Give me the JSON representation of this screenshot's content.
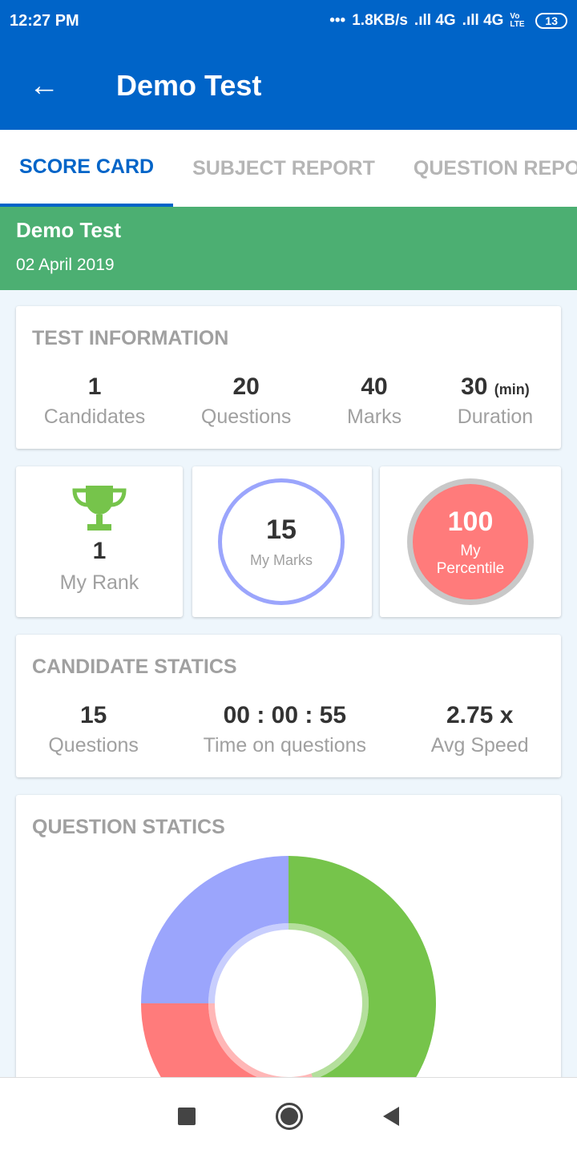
{
  "status_bar": {
    "time": "12:27 PM",
    "dots": "•••",
    "speed": "1.8KB/s",
    "net1": ".ıll 4G",
    "net2": ".ıll 4G",
    "volte": "Vo LTE",
    "battery": "13"
  },
  "app_bar": {
    "title": "Demo Test",
    "back_icon": "arrow-left"
  },
  "tabs": [
    {
      "label": "SCORE CARD",
      "active": true
    },
    {
      "label": "SUBJECT REPORT"
    },
    {
      "label": "QUESTION REPORT"
    }
  ],
  "banner": {
    "title": "Demo Test",
    "date": "02 April 2019",
    "color": "#4caf72"
  },
  "test_info": {
    "title": "TEST INFORMATION",
    "items": [
      {
        "value": "1",
        "label": "Candidates"
      },
      {
        "value": "20",
        "label": "Questions"
      },
      {
        "value": "40",
        "label": "Marks"
      },
      {
        "value": "30",
        "unit": "(min)",
        "label": "Duration"
      }
    ]
  },
  "rank": {
    "value": "1",
    "label": "My Rank",
    "icon": "trophy"
  },
  "marks": {
    "value": "15",
    "label": "My Marks"
  },
  "percentile": {
    "value": "100",
    "label": "My Percentile"
  },
  "candidate_stats": {
    "title": "CANDIDATE STATICS",
    "items": [
      {
        "value": "15",
        "label": "Questions"
      },
      {
        "value": "00 : 00 : 55",
        "label": "Time on questions"
      },
      {
        "value": "2.75 x",
        "label": "Avg Speed"
      }
    ]
  },
  "question_stats": {
    "title": "QUESTION STATICS"
  },
  "chart_data": {
    "type": "pie",
    "donut": true,
    "values": [
      9,
      6,
      5
    ],
    "colors": [
      "#76c44b",
      "#ff7b7b",
      "#9ba5fc"
    ]
  }
}
